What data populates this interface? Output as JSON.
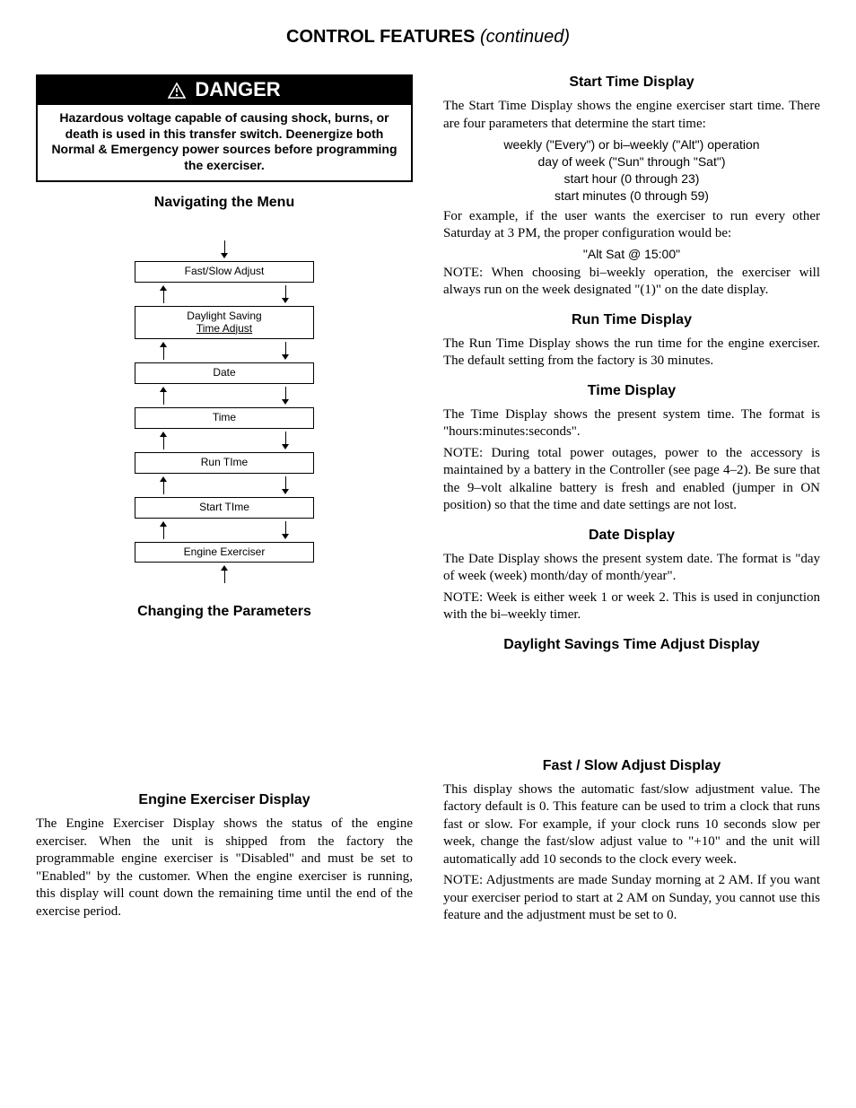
{
  "pageTitle": {
    "bold": "CONTROL FEATURES",
    "italic": "(continued)"
  },
  "danger": {
    "heading": "DANGER",
    "body": "Hazardous voltage capable of causing shock, burns, or death is used in this transfer switch. Deenergize both Normal & Emergency power sources before programming the exerciser."
  },
  "left": {
    "navHeading": "Navigating the Menu",
    "flow": {
      "b1": "Fast/Slow Adjust",
      "b2a": "Daylight Saving",
      "b2b": "Time Adjust",
      "b3": "Date",
      "b4": "Time",
      "b5": "Run TIme",
      "b6": "Start TIme",
      "b7": "Engine Exerciser"
    },
    "changeHeading": "Changing the Parameters",
    "engExHeading": "Engine Exerciser Display",
    "engExBody": "The Engine Exerciser Display shows the status of the engine exerciser. When the unit is shipped from the factory the programmable engine exerciser is \"Disabled\" and must be set to \"Enabled\" by the customer. When the engine exerciser is running, this display will count down the remaining time until the end of the exercise period."
  },
  "right": {
    "startHeading": "Start Time Display",
    "startIntro": "The Start Time Display shows the engine exerciser start time. There are four parameters that determine the start time:",
    "startList": {
      "l1": "weekly (\"Every\") or bi–weekly (\"Alt\") operation",
      "l2": "day of week (\"Sun\" through \"Sat\")",
      "l3": "start hour (0 through 23)",
      "l4": "start minutes (0 through 59)"
    },
    "startExIntro": "For example, if the user wants the exerciser to run every other Saturday at 3 PM, the proper configuration would be:",
    "startExample": "\"Alt Sat @ 15:00\"",
    "startNote": "NOTE: When choosing bi–weekly operation, the exerciser will always run on the week designated \"(1)\" on the date display.",
    "runHeading": "Run Time Display",
    "runBody": "The Run Time Display shows the run time for the engine exerciser. The default setting from the factory is 30 minutes.",
    "timeHeading": "Time Display",
    "timeBody": "The Time Display shows the present system time. The format is \"hours:minutes:seconds\".",
    "timeNote": "NOTE: During total power outages, power to the accessory is maintained by a battery in the Controller (see page 4–2). Be sure that the 9–volt alkaline battery is fresh and enabled (jumper in ON position) so that the time and date settings are not lost.",
    "dateHeading": "Date Display",
    "dateBody": "The Date Display shows the present system date. The format is \"day of week (week) month/day of month/year\".",
    "dateNote": "NOTE: Week is either week 1 or week 2. This is used in conjunction with the bi–weekly timer.",
    "dstHeading": "Daylight Savings Time Adjust Display",
    "fastHeading": "Fast / Slow Adjust Display",
    "fastBody": "This display shows the automatic fast/slow adjustment value. The factory default is 0. This feature can be used to trim a clock that runs fast or slow. For example, if your clock runs 10 seconds slow per week, change the fast/slow adjust value to \"+10\" and the unit will automatically add 10 seconds to the clock every week.",
    "fastNote": "NOTE: Adjustments are made Sunday morning at 2 AM. If you want your exerciser period to start at 2 AM on Sunday, you cannot use this feature and the adjustment must be set to 0."
  }
}
